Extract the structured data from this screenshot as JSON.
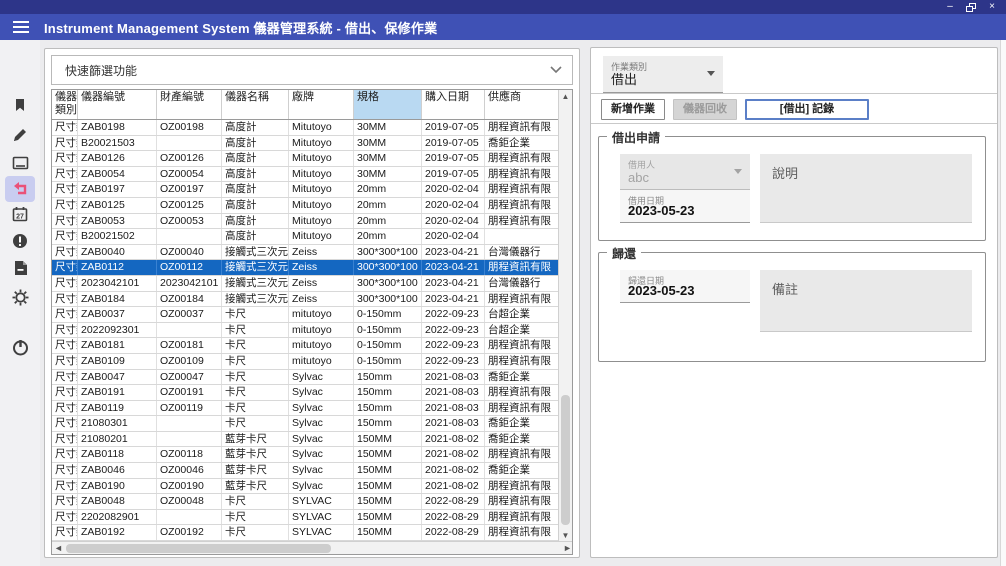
{
  "window": {
    "minimize": "–",
    "maximize": "restore",
    "close": "×"
  },
  "app_bar": {
    "title": "Instrument Management System 儀器管理系統 - 借出、保修作業"
  },
  "sidebar": {
    "active_item": "return-loan",
    "items": [
      {
        "name": "bookmark"
      },
      {
        "name": "edit"
      },
      {
        "name": "window"
      },
      {
        "name": "return-loan"
      },
      {
        "name": "calendar"
      },
      {
        "name": "alert"
      },
      {
        "name": "document"
      },
      {
        "name": "settings"
      },
      {
        "name": "power"
      }
    ]
  },
  "filter": {
    "label": "快速篩選功能"
  },
  "table": {
    "columns": [
      "儀器類別",
      "儀器編號",
      "財產編號",
      "儀器名稱",
      "廠牌",
      "規格",
      "購入日期",
      "供應商"
    ],
    "highlight_column": 5,
    "selected_row": 9,
    "rows": [
      [
        "尺寸類",
        "ZAB0198",
        "OZ00198",
        "高度計",
        "Mitutoyo",
        "30MM",
        "2019-07-05",
        "朋程資訊有限"
      ],
      [
        "尺寸類",
        "B20021503",
        "",
        "高度計",
        "Mitutoyo",
        "30MM",
        "2019-07-05",
        "喬鉅企業"
      ],
      [
        "尺寸類",
        "ZAB0126",
        "OZ00126",
        "高度計",
        "Mitutoyo",
        "30MM",
        "2019-07-05",
        "朋程資訊有限"
      ],
      [
        "尺寸類",
        "ZAB0054",
        "OZ00054",
        "高度計",
        "Mitutoyo",
        "30MM",
        "2019-07-05",
        "朋程資訊有限"
      ],
      [
        "尺寸類",
        "ZAB0197",
        "OZ00197",
        "高度計",
        "Mitutoyo",
        "20mm",
        "2020-02-04",
        "朋程資訊有限"
      ],
      [
        "尺寸類",
        "ZAB0125",
        "OZ00125",
        "高度計",
        "Mitutoyo",
        "20mm",
        "2020-02-04",
        "朋程資訊有限"
      ],
      [
        "尺寸類",
        "ZAB0053",
        "OZ00053",
        "高度計",
        "Mitutoyo",
        "20mm",
        "2020-02-04",
        "朋程資訊有限"
      ],
      [
        "尺寸類",
        "B20021502",
        "",
        "高度計",
        "Mitutoyo",
        "20mm",
        "2020-02-04",
        ""
      ],
      [
        "尺寸類",
        "ZAB0040",
        "OZ00040",
        "接觸式三次元",
        "Zeiss",
        "300*300*100",
        "2023-04-21",
        "台灣儀器行"
      ],
      [
        "尺寸類",
        "ZAB0112",
        "OZ00112",
        "接觸式三次元",
        "Zeiss",
        "300*300*100",
        "2023-04-21",
        "朋程資訊有限"
      ],
      [
        "尺寸類",
        "2023042101",
        "2023042101",
        "接觸式三次元",
        "Zeiss",
        "300*300*100",
        "2023-04-21",
        "台灣儀器行"
      ],
      [
        "尺寸類",
        "ZAB0184",
        "OZ00184",
        "接觸式三次元",
        "Zeiss",
        "300*300*100",
        "2023-04-21",
        "朋程資訊有限"
      ],
      [
        "尺寸類",
        "ZAB0037",
        "OZ00037",
        "卡尺",
        "mitutoyo",
        "0-150mm",
        "2022-09-23",
        "台超企業"
      ],
      [
        "尺寸類",
        "2022092301",
        "",
        "卡尺",
        "mitutoyo",
        "0-150mm",
        "2022-09-23",
        "台超企業"
      ],
      [
        "尺寸類",
        "ZAB0181",
        "OZ00181",
        "卡尺",
        "mitutoyo",
        "0-150mm",
        "2022-09-23",
        "朋程資訊有限"
      ],
      [
        "尺寸類",
        "ZAB0109",
        "OZ00109",
        "卡尺",
        "mitutoyo",
        "0-150mm",
        "2022-09-23",
        "朋程資訊有限"
      ],
      [
        "尺寸類",
        "ZAB0047",
        "OZ00047",
        "卡尺",
        "Sylvac",
        "150mm",
        "2021-08-03",
        "喬鉅企業"
      ],
      [
        "尺寸類",
        "ZAB0191",
        "OZ00191",
        "卡尺",
        "Sylvac",
        "150mm",
        "2021-08-03",
        "朋程資訊有限"
      ],
      [
        "尺寸類",
        "ZAB0119",
        "OZ00119",
        "卡尺",
        "Sylvac",
        "150mm",
        "2021-08-03",
        "朋程資訊有限"
      ],
      [
        "尺寸類",
        "21080301",
        "",
        "卡尺",
        "Sylvac",
        "150mm",
        "2021-08-03",
        "喬鉅企業"
      ],
      [
        "尺寸類",
        "21080201",
        "",
        "藍芽卡尺",
        "Sylvac",
        "150MM",
        "2021-08-02",
        "喬鉅企業"
      ],
      [
        "尺寸類",
        "ZAB0118",
        "OZ00118",
        "藍芽卡尺",
        "Sylvac",
        "150MM",
        "2021-08-02",
        "朋程資訊有限"
      ],
      [
        "尺寸類",
        "ZAB0046",
        "OZ00046",
        "藍芽卡尺",
        "Sylvac",
        "150MM",
        "2021-08-02",
        "喬鉅企業"
      ],
      [
        "尺寸類",
        "ZAB0190",
        "OZ00190",
        "藍芽卡尺",
        "Sylvac",
        "150MM",
        "2021-08-02",
        "朋程資訊有限"
      ],
      [
        "尺寸類",
        "ZAB0048",
        "OZ00048",
        "卡尺",
        "SYLVAC",
        "150MM",
        "2022-08-29",
        "朋程資訊有限"
      ],
      [
        "尺寸類",
        "2202082901",
        "",
        "卡尺",
        "SYLVAC",
        "150MM",
        "2022-08-29",
        "朋程資訊有限"
      ],
      [
        "尺寸類",
        "ZAB0192",
        "OZ00192",
        "卡尺",
        "SYLVAC",
        "150MM",
        "2022-08-29",
        "朋程資訊有限"
      ]
    ]
  },
  "right_panel": {
    "operation_type": {
      "label": "作業類別",
      "value": "借出"
    },
    "toolbar": {
      "new_job": "新增作業",
      "recall": "儀器回收",
      "record": "[借出] 記錄"
    },
    "borrow_section": {
      "title": "借出申請",
      "borrower": {
        "label": "借用人",
        "value": "abc"
      },
      "borrow_date": {
        "label": "借用日期",
        "value": "2023-05-23"
      },
      "description_placeholder": "說明"
    },
    "return_section": {
      "title": "歸還",
      "return_date": {
        "label": "歸還日期",
        "value": "2023-05-23"
      },
      "remarks_placeholder": "備註"
    }
  },
  "colors": {
    "title_strip": "#2d3589",
    "app_bar": "#3f51b5",
    "selected_row": "#1467c1",
    "highlight_column": "#b9d9f2",
    "active_sidebar_bg": "#c9cdf0",
    "active_sidebar_icon": "#ea5178",
    "record_button_border": "#5b7fc7"
  }
}
